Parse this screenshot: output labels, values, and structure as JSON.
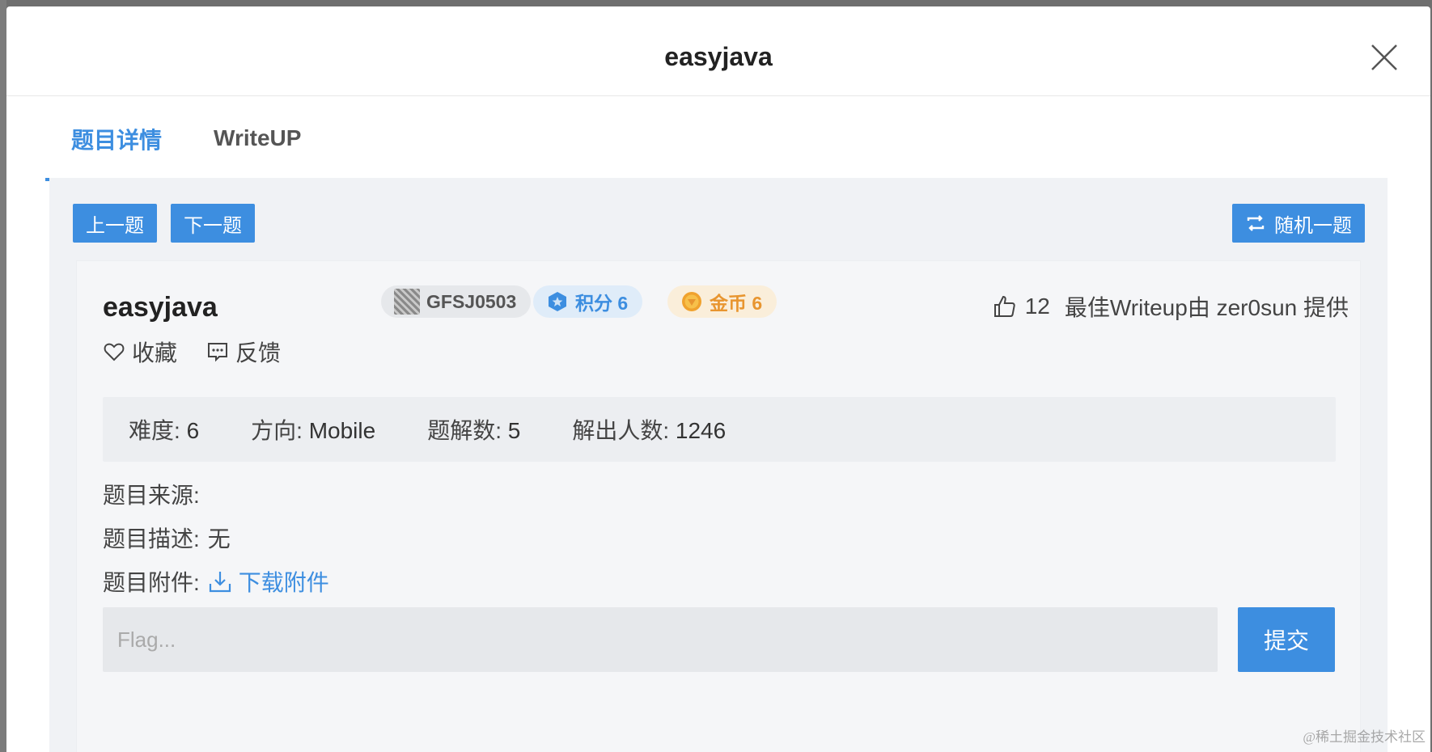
{
  "modal": {
    "title": "easyjava"
  },
  "tabs": [
    {
      "label": "题目详情",
      "active": true
    },
    {
      "label": "WriteUP",
      "active": false
    }
  ],
  "nav": {
    "prev_label": "上一题",
    "next_label": "下一题",
    "random_label": "随机一题"
  },
  "challenge": {
    "title": "easyjava",
    "author": "GFSJ0503",
    "score_label": "积分 6",
    "coin_label": "金币 6",
    "likes": "12",
    "best_writeup": "最佳Writeup由 zer0sun 提供",
    "favorite_label": "收藏",
    "feedback_label": "反馈"
  },
  "stats": {
    "difficulty_label": "难度:",
    "difficulty": "6",
    "direction_label": "方向:",
    "direction": "Mobile",
    "writeups_label": "题解数:",
    "writeups": "5",
    "solvers_label": "解出人数:",
    "solvers": "1246"
  },
  "info": {
    "source_label": "题目来源:",
    "source": "",
    "description_label": "题目描述:",
    "description": "无",
    "attachment_label": "题目附件:",
    "download_label": "下载附件"
  },
  "flag": {
    "placeholder": "Flag...",
    "submit_label": "提交"
  },
  "watermark": "@稀土掘金技术社区",
  "colors": {
    "accent": "#3d8ee0",
    "coin": "#e8952f",
    "backdrop": "#6f6f6f"
  }
}
